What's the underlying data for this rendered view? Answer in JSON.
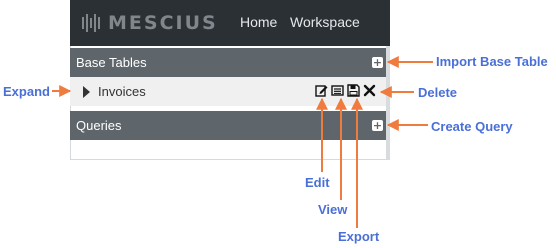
{
  "app": {
    "logo_text": "MESCIUS",
    "nav": [
      {
        "label": "Home"
      },
      {
        "label": "Workspace"
      }
    ]
  },
  "sections": {
    "base_tables": {
      "title": "Base Tables",
      "add_icon": "plus-square-icon"
    },
    "queries": {
      "title": "Queries",
      "add_icon": "plus-square-icon"
    }
  },
  "tables": [
    {
      "name": "Invoices",
      "actions": [
        "edit-icon",
        "view-icon",
        "export-icon",
        "delete-icon"
      ]
    }
  ],
  "annotations": {
    "import": "Import Base Table",
    "expand": "Expand",
    "delete": "Delete",
    "create_query": "Create Query",
    "edit": "Edit",
    "view": "View",
    "export": "Export"
  },
  "colors": {
    "callout": "#4a6fd6",
    "arrow": "#f07b3f",
    "topbar": "#2b3034",
    "section_header": "#5f666b"
  }
}
